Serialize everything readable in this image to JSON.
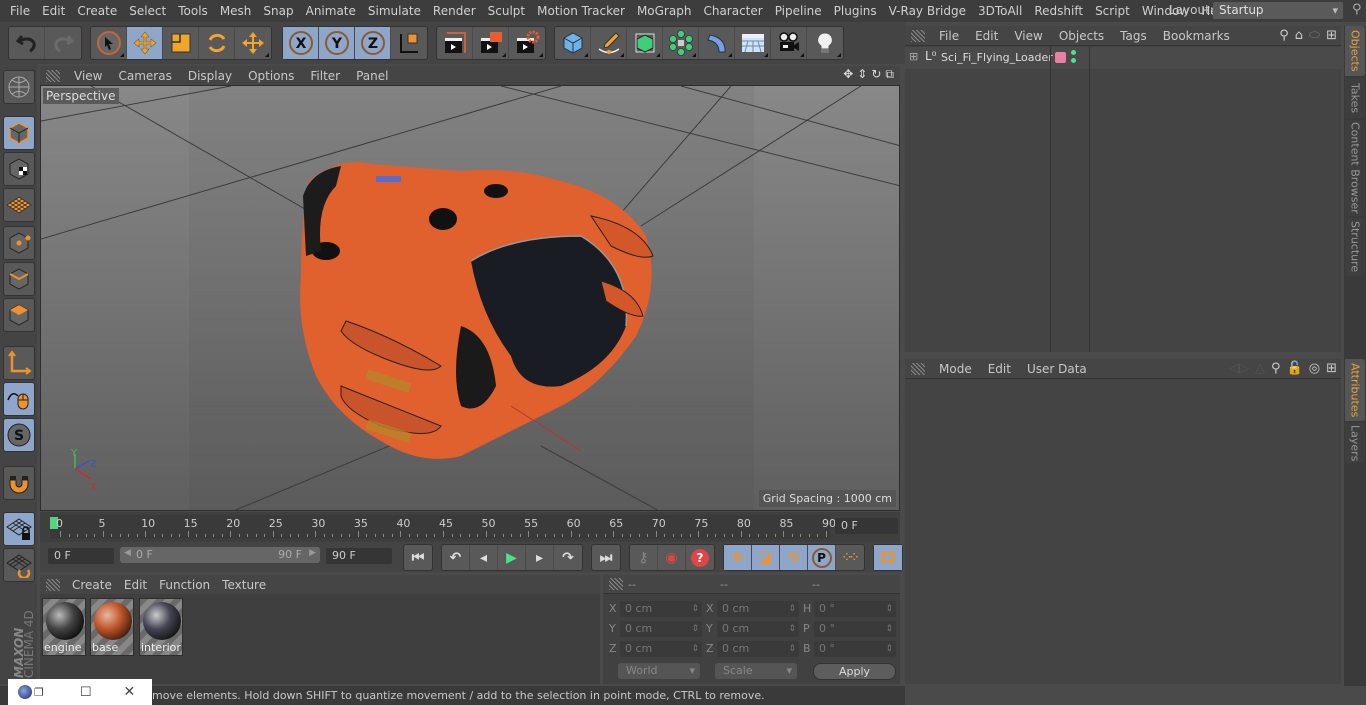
{
  "menubar": {
    "items": [
      "File",
      "Edit",
      "Create",
      "Select",
      "Tools",
      "Mesh",
      "Snap",
      "Animate",
      "Simulate",
      "Render",
      "Sculpt",
      "Motion Tracker",
      "MoGraph",
      "Character",
      "Pipeline",
      "Plugins",
      "V-Ray Bridge",
      "3DToAll",
      "Redshift",
      "Script",
      "Window",
      "Help"
    ],
    "layout_label": "Layout:",
    "layout_value": "Startup"
  },
  "toolbar": {
    "undo": "undo-icon",
    "redo": "redo-icon",
    "tools": [
      "live-selection",
      "move",
      "scale",
      "rotate",
      "last-tool"
    ],
    "axes": [
      "X",
      "Y",
      "Z"
    ],
    "coord_system": "world-coordinate-icon",
    "render": [
      "render-view",
      "render-picture-viewer",
      "render-settings"
    ],
    "objects": [
      "cube",
      "pen",
      "subdivision",
      "mograph-cloner",
      "deformer",
      "floor",
      "camera",
      "light"
    ]
  },
  "viewport": {
    "menu": [
      "View",
      "Cameras",
      "Display",
      "Options",
      "Filter",
      "Panel"
    ],
    "camera_label": "Perspective",
    "grid_spacing": "Grid Spacing : 1000 cm",
    "axis_labels": {
      "x": "X",
      "y": "Y",
      "z": "Z"
    }
  },
  "timeline": {
    "ticks": [
      "0",
      "5",
      "10",
      "15",
      "20",
      "25",
      "30",
      "35",
      "40",
      "45",
      "50",
      "55",
      "60",
      "65",
      "70",
      "75",
      "80",
      "85",
      "90"
    ],
    "current_frame_field": "0 F",
    "start_field": "0 F",
    "range_start": "0 F",
    "range_end": "90 F",
    "end_field": "90 F",
    "current_frame": 0
  },
  "materials": {
    "menu": [
      "Create",
      "Edit",
      "Function",
      "Texture"
    ],
    "items": [
      {
        "name": "engine"
      },
      {
        "name": "base"
      },
      {
        "name": "interior"
      }
    ]
  },
  "coordinates": {
    "headers": [
      "--",
      "--",
      "--"
    ],
    "rows": [
      {
        "l1": "X",
        "v1": "0 cm",
        "l2": "X",
        "v2": "0 cm",
        "l3": "H",
        "v3": "0 °"
      },
      {
        "l1": "Y",
        "v1": "0 cm",
        "l2": "Y",
        "v2": "0 cm",
        "l3": "P",
        "v3": "0 °"
      },
      {
        "l1": "Z",
        "v1": "0 cm",
        "l2": "Z",
        "v2": "0 cm",
        "l3": "B",
        "v3": "0 °"
      }
    ],
    "space": "World",
    "mode": "Scale",
    "apply": "Apply"
  },
  "objects_panel": {
    "menu": [
      "File",
      "Edit",
      "View",
      "Objects",
      "Tags",
      "Bookmarks"
    ],
    "items": [
      {
        "name": "Sci_Fi_Flying_Loader",
        "tag_color": "#e87fa6"
      }
    ]
  },
  "attributes_panel": {
    "menu": [
      "Mode",
      "Edit",
      "User Data"
    ]
  },
  "side_tabs": {
    "top": [
      "Objects",
      "Takes",
      "Content Browser",
      "Structure"
    ],
    "bottom": [
      "Attributes",
      "Layers"
    ]
  },
  "status": {
    "text": "move elements. Hold down SHIFT to quantize movement / add to the selection in point mode, CTRL to remove."
  },
  "branding": {
    "maxon": "MAXON",
    "product": "CINEMA 4D"
  },
  "colors": {
    "accent_orange": "#f0922c",
    "active_blue": "#8ea6c9",
    "model_orange": "#e0602e"
  }
}
